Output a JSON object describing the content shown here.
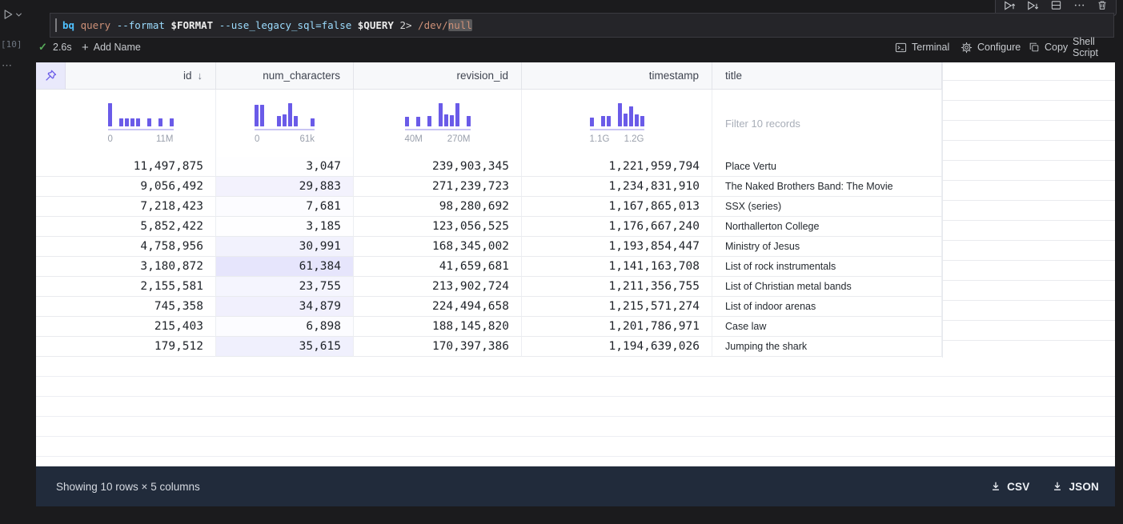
{
  "app": {
    "background": "#1b1b1d",
    "accent_purple": "#6a5be8",
    "footer_bg": "#212b3b"
  },
  "gutter": {
    "execution_count": "[10]",
    "more": "⋯"
  },
  "cell_toolbar": {
    "buttons": [
      "execute-above",
      "execute-below",
      "split-cell",
      "more-actions",
      "delete-cell"
    ]
  },
  "editor": {
    "code_tokens": [
      {
        "text": "bq ",
        "color": "#4fc1ff",
        "bold": true
      },
      {
        "text": "query ",
        "color": "#ce9178"
      },
      {
        "text": "--format ",
        "color": "#9cdcfe"
      },
      {
        "text": "$FORMAT ",
        "color": "#ececec",
        "bold": true
      },
      {
        "text": "--use_legacy_sql=false ",
        "color": "#9cdcfe"
      },
      {
        "text": "$QUERY ",
        "color": "#ececec",
        "bold": true
      },
      {
        "text": "2> ",
        "color": "#d4d4d4"
      },
      {
        "text": "/dev/",
        "color": "#ce9178"
      },
      {
        "text": "null",
        "color": "#ce9178",
        "highlight": true
      }
    ]
  },
  "status_bar": {
    "success_check": "✓",
    "duration": "2.6s",
    "add_name_label": "Add Name",
    "right_items": [
      {
        "label": "Terminal"
      },
      {
        "label": "Configure"
      },
      {
        "label": "Copy"
      },
      {
        "label": "Shell Script"
      }
    ]
  },
  "table": {
    "columns": [
      {
        "key": "id",
        "label": "id",
        "align": "right",
        "sorted": "desc",
        "sort_arrow": "↓",
        "hist": {
          "bars": [
            100,
            0,
            33,
            33,
            33,
            33,
            0,
            33,
            0,
            33,
            0,
            33
          ],
          "min_label": "0",
          "max_label": "11M"
        }
      },
      {
        "key": "num_characters",
        "label": "num_characters",
        "align": "right",
        "shade": true,
        "hist": {
          "bars": [
            93,
            93,
            0,
            0,
            45,
            50,
            100,
            45,
            0,
            0,
            33
          ],
          "min_label": "0",
          "max_label": "61k"
        }
      },
      {
        "key": "revision_id",
        "label": "revision_id",
        "align": "right",
        "hist": {
          "bars": [
            40,
            0,
            40,
            0,
            45,
            0,
            100,
            50,
            48,
            100,
            0,
            45
          ],
          "min_label": "40M",
          "max_label": "270M"
        }
      },
      {
        "key": "timestamp",
        "label": "timestamp",
        "align": "right",
        "hist": {
          "bars": [
            38,
            0,
            45,
            45,
            0,
            100,
            55,
            85,
            50,
            45
          ],
          "min_label": "1.1G",
          "max_label": "1.2G"
        }
      },
      {
        "key": "title",
        "label": "title",
        "align": "left",
        "filter_placeholder": "Filter 10 records"
      }
    ],
    "rows": [
      {
        "id": "11,497,875",
        "num_characters": "3,047",
        "revision_id": "239,903,345",
        "timestamp": "1,221,959,794",
        "title": "Place Vertu"
      },
      {
        "id": "9,056,492",
        "num_characters": "29,883",
        "revision_id": "271,239,723",
        "timestamp": "1,234,831,910",
        "title": "The Naked Brothers Band: The Movie"
      },
      {
        "id": "7,218,423",
        "num_characters": "7,681",
        "revision_id": "98,280,692",
        "timestamp": "1,167,865,013",
        "title": "SSX (series)"
      },
      {
        "id": "5,852,422",
        "num_characters": "3,185",
        "revision_id": "123,056,525",
        "timestamp": "1,176,667,240",
        "title": "Northallerton College"
      },
      {
        "id": "4,758,956",
        "num_characters": "30,991",
        "revision_id": "168,345,002",
        "timestamp": "1,193,854,447",
        "title": "Ministry of Jesus"
      },
      {
        "id": "3,180,872",
        "num_characters": "61,384",
        "revision_id": "41,659,681",
        "timestamp": "1,141,163,708",
        "title": "List of rock instrumentals"
      },
      {
        "id": "2,155,581",
        "num_characters": "23,755",
        "revision_id": "213,902,724",
        "timestamp": "1,211,356,755",
        "title": "List of Christian metal bands"
      },
      {
        "id": "745,358",
        "num_characters": "34,879",
        "revision_id": "224,494,658",
        "timestamp": "1,215,571,274",
        "title": "List of indoor arenas"
      },
      {
        "id": "215,403",
        "num_characters": "6,898",
        "revision_id": "188,145,820",
        "timestamp": "1,201,786,971",
        "title": "Case law"
      },
      {
        "id": "179,512",
        "num_characters": "35,615",
        "revision_id": "170,397,386",
        "timestamp": "1,194,639,026",
        "title": "Jumping the shark"
      }
    ]
  },
  "footer": {
    "summary": "Showing 10 rows × 5 columns",
    "csv_label": "CSV",
    "json_label": "JSON"
  }
}
